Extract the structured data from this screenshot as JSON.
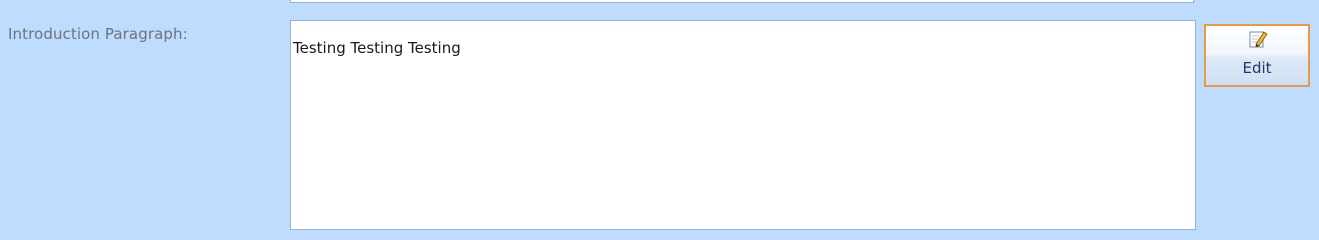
{
  "form": {
    "field_label": "Introduction Paragraph:",
    "field_value": "Testing Testing Testing"
  },
  "toolbar": {
    "edit_label": "Edit",
    "edit_icon": "pencil-icon"
  },
  "colors": {
    "background": "#bfdbfe",
    "field_border": "#93b4de",
    "button_border": "#e39b4e"
  }
}
